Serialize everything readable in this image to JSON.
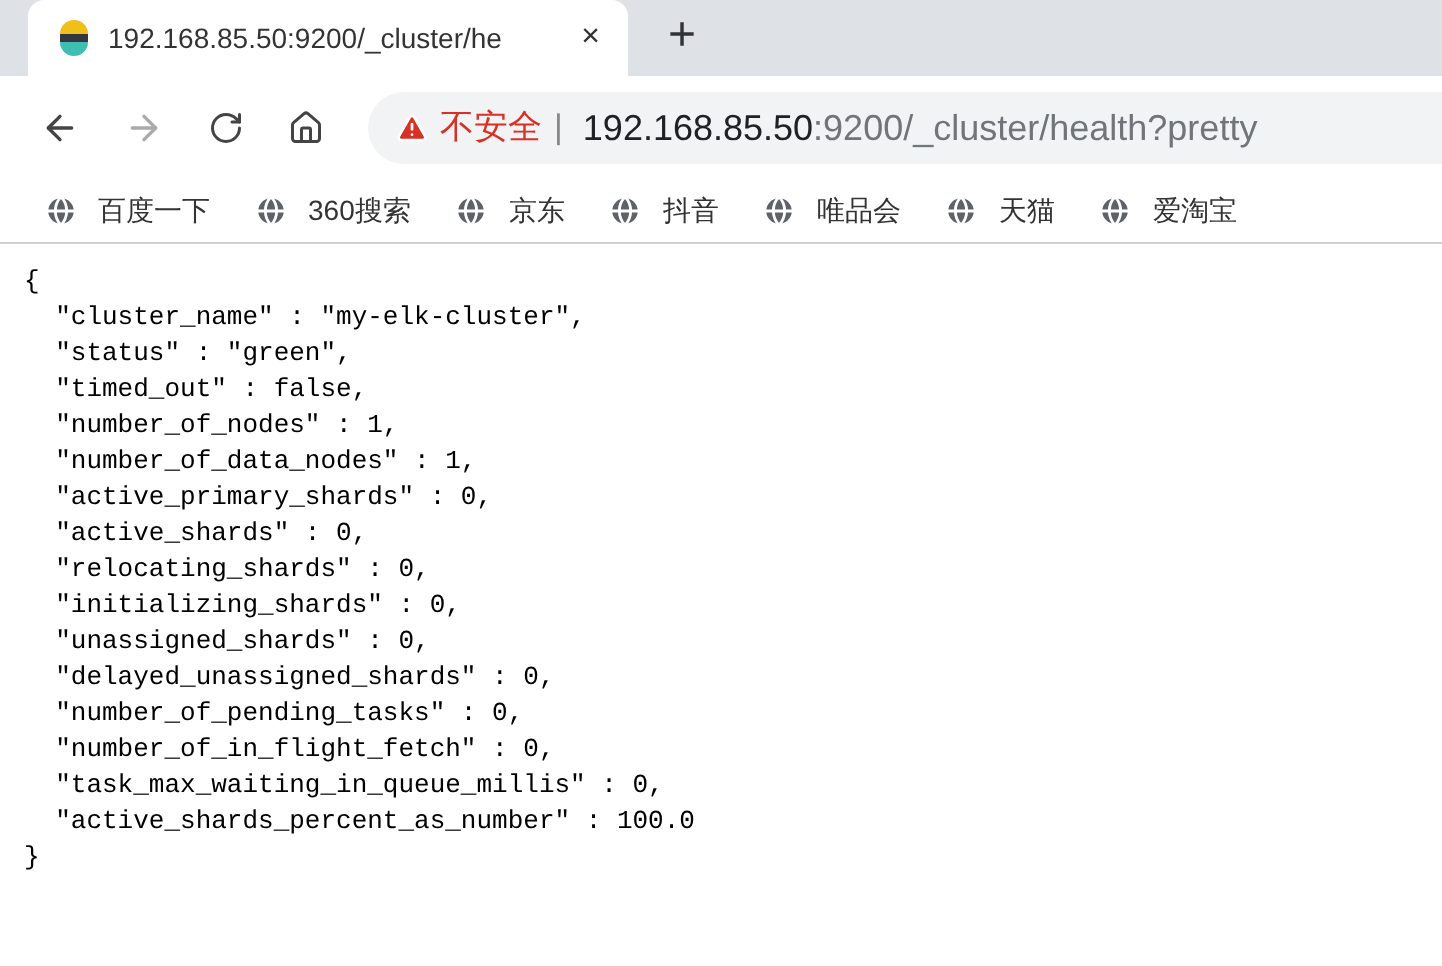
{
  "tab": {
    "title": "192.168.85.50:9200/_cluster/he",
    "close": "×",
    "selected": true
  },
  "new_tab": "+",
  "address_bar": {
    "security_label": "不安全",
    "separator": "|",
    "host": "192.168.85.50",
    "path": ":9200/_cluster/health?pretty"
  },
  "bookmarks": [
    "百度一下",
    "360搜索",
    "京东",
    "抖音",
    "唯品会",
    "天猫",
    "爱淘宝"
  ],
  "content_lines": [
    "{",
    "  \"cluster_name\" : \"my-elk-cluster\",",
    "  \"status\" : \"green\",",
    "  \"timed_out\" : false,",
    "  \"number_of_nodes\" : 1,",
    "  \"number_of_data_nodes\" : 1,",
    "  \"active_primary_shards\" : 0,",
    "  \"active_shards\" : 0,",
    "  \"relocating_shards\" : 0,",
    "  \"initializing_shards\" : 0,",
    "  \"unassigned_shards\" : 0,",
    "  \"delayed_unassigned_shards\" : 0,",
    "  \"number_of_pending_tasks\" : 0,",
    "  \"number_of_in_flight_fetch\" : 0,",
    "  \"task_max_waiting_in_queue_millis\" : 0,",
    "  \"active_shards_percent_as_number\" : 100.0",
    "}"
  ]
}
